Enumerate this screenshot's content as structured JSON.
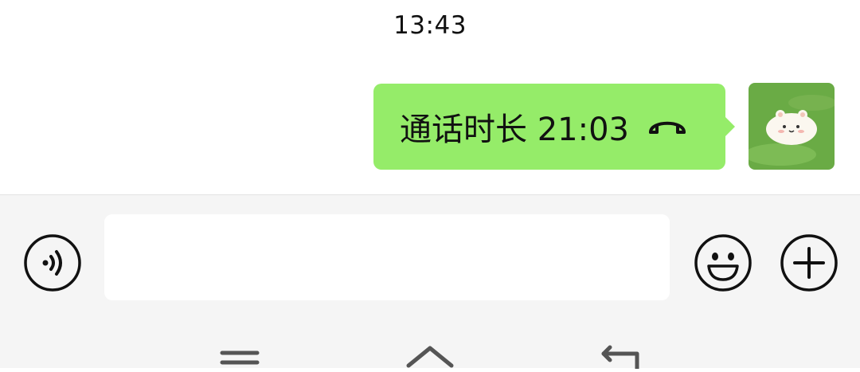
{
  "chat": {
    "timestamp": "13:43",
    "message": {
      "text": "通话时长 21:03",
      "icon": "hangup-phone-icon",
      "bubble_color": "#95ec69"
    },
    "avatar": {
      "icon": "hamster-avatar-icon"
    }
  },
  "input_bar": {
    "voice_icon": "voice-input-icon",
    "text_value": "",
    "emoji_icon": "emoji-icon",
    "plus_icon": "plus-icon"
  },
  "system_nav": {
    "items": [
      "menu-icon",
      "home-icon",
      "back-icon"
    ]
  }
}
